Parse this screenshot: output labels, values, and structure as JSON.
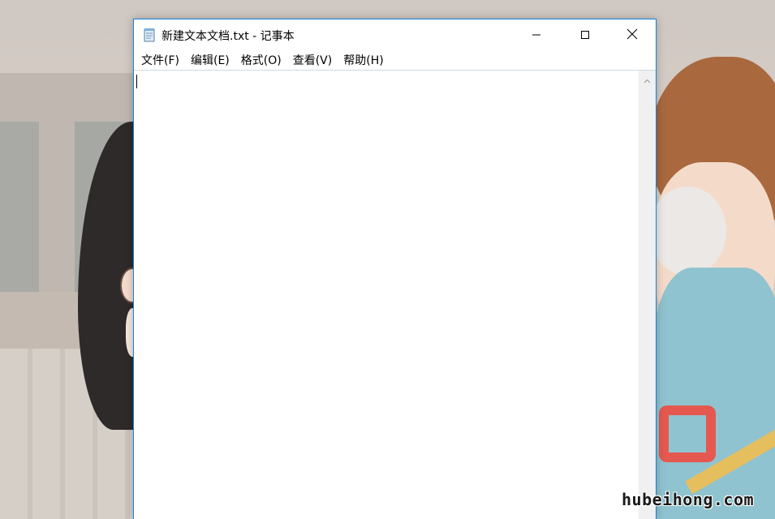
{
  "window": {
    "title": "新建文本文档.txt - 记事本",
    "icons": {
      "app": "notepad-icon",
      "minimize": "minimize-icon",
      "maximize": "maximize-icon",
      "close": "close-icon",
      "scroll_up": "chevron-up-icon"
    }
  },
  "menu": {
    "items": [
      {
        "label": "文件(F)"
      },
      {
        "label": "编辑(E)"
      },
      {
        "label": "格式(O)"
      },
      {
        "label": "查看(V)"
      },
      {
        "label": "帮助(H)"
      }
    ]
  },
  "editor": {
    "content": ""
  },
  "watermark": "hubeihong.com",
  "colors": {
    "window_border": "#1883d7",
    "scrollbar_track": "#f0f0f0"
  }
}
